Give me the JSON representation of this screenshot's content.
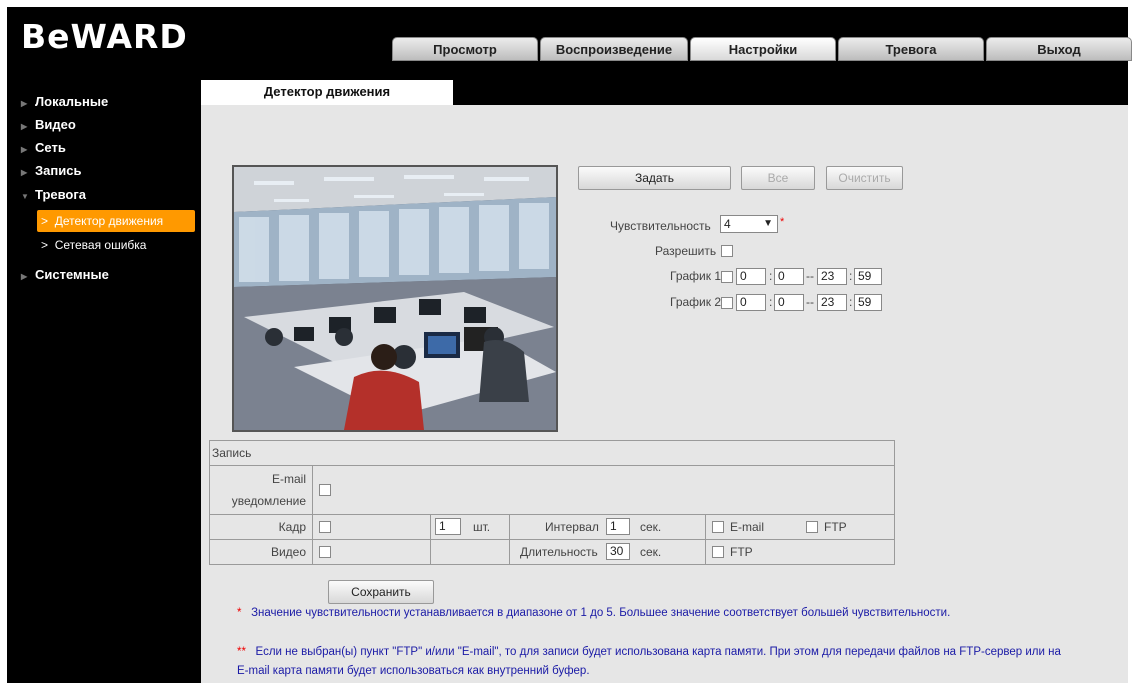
{
  "brand": {
    "logo_text": "BeWARD"
  },
  "nav_tabs": [
    {
      "label": "Просмотр"
    },
    {
      "label": "Воспроизведение"
    },
    {
      "label": "Настройки",
      "active": true
    },
    {
      "label": "Тревога"
    },
    {
      "label": "Выход"
    }
  ],
  "sidebar": {
    "items": [
      {
        "label": "Локальные"
      },
      {
        "label": "Видео"
      },
      {
        "label": "Сеть"
      },
      {
        "label": "Запись"
      },
      {
        "label": "Тревога",
        "expanded": true
      },
      {
        "label": "Системные"
      }
    ],
    "subitems": [
      {
        "label": "Детектор движения",
        "active": true
      },
      {
        "label": "Сетевая ошибка"
      }
    ]
  },
  "page": {
    "tab_title": "Детектор движения"
  },
  "controls": {
    "set_button": "Задать",
    "all_button": "Все",
    "clear_button": "Очистить",
    "sensitivity_label": "Чувствительность",
    "sensitivity_value": "4",
    "sensitivity_marker": "*",
    "enable_label": "Разрешить",
    "schedule1_label": "График 1",
    "schedule2_label": "График 2",
    "schedule1": {
      "start_h": "0",
      "start_m": "0",
      "end_h": "23",
      "end_m": "59"
    },
    "schedule2": {
      "start_h": "0",
      "start_m": "0",
      "end_h": "23",
      "end_m": "59"
    },
    "colon": ":",
    "dash": "--"
  },
  "record": {
    "header": "Запись",
    "email_label_1": "E-mail",
    "email_label_2": "уведомление",
    "frame_label": "Кадр",
    "frame_count": "1",
    "frame_unit": "шт.",
    "interval_label": "Интервал",
    "interval_value": "1",
    "interval_unit": "сек.",
    "frame_email": "E-mail",
    "frame_ftp": "FTP",
    "video_label": "Видео",
    "duration_label": "Длительность",
    "duration_value": "30",
    "duration_unit": "сек.",
    "video_ftp": "FTP"
  },
  "save_button": "Сохранить",
  "notes": {
    "note1_marker": "*",
    "note1": "Значение чувствительности устанавливается в диапазоне от 1 до 5. Большее значение соответствует большей чувствительности.",
    "note2_marker": "**",
    "note2_line1": "Если не выбран(ы) пункт \"FTP\" и/или \"E-mail\", то для записи будет использована карта памяти. При этом для передачи файлов на FTP-сервер или на",
    "note2_line2": "E-mail карта памяти будет использоваться как внутренний буфер."
  },
  "colors": {
    "accent": "#ff9900",
    "note_text": "#1a1aa6",
    "required": "#e00000"
  },
  "icons": [
    "triangle-right-icon",
    "triangle-down-icon",
    "chevron-right-icon",
    "chevron-down-icon"
  ]
}
